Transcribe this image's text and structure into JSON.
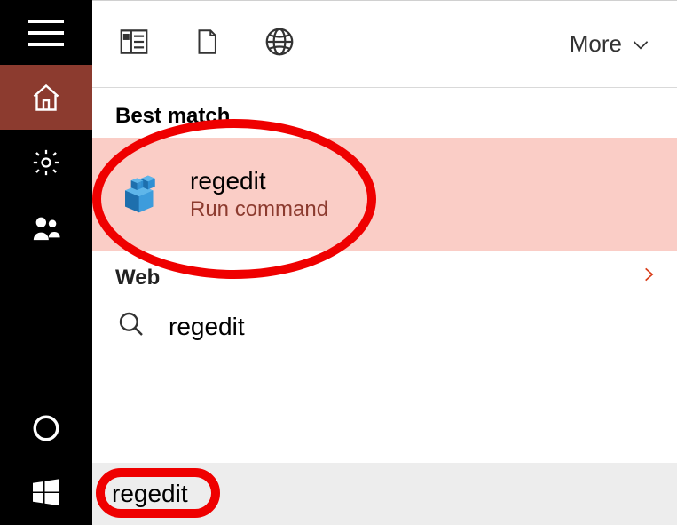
{
  "sidebar": {
    "items": [
      "menu",
      "home",
      "settings",
      "people",
      "cortana",
      "start"
    ]
  },
  "topbar": {
    "filters": [
      "news",
      "document",
      "web"
    ],
    "more_label": "More"
  },
  "sections": {
    "best_match_label": "Best match",
    "best_match_item": {
      "title": "regedit",
      "subtitle": "Run command",
      "icon": "registry-cubes"
    },
    "web_label": "Web",
    "web_results": [
      {
        "query": "regedit"
      }
    ]
  },
  "search": {
    "value": "regedit",
    "placeholder": ""
  },
  "colors": {
    "accent": "#8c3b2f",
    "highlight_bg": "#facdc6",
    "annotation": "#ef0000"
  }
}
